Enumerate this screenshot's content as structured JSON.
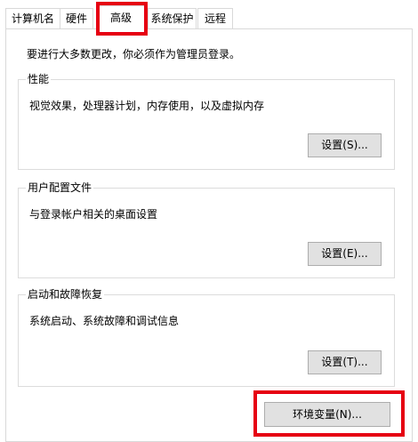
{
  "tabs": [
    {
      "label": "计算机名",
      "active": false
    },
    {
      "label": "硬件",
      "active": false
    },
    {
      "label": "高级",
      "active": true
    },
    {
      "label": "系统保护",
      "active": false
    },
    {
      "label": "远程",
      "active": false
    }
  ],
  "notice": "要进行大多数更改，你必须作为管理员登录。",
  "performance": {
    "title": "性能",
    "description": "视觉效果，处理器计划，内存使用，以及虚拟内存",
    "button": "设置(S)..."
  },
  "user_profiles": {
    "title": "用户配置文件",
    "description": "与登录帐户相关的桌面设置",
    "button": "设置(E)..."
  },
  "startup_recovery": {
    "title": "启动和故障恢复",
    "description": "系统启动、系统故障和调试信息",
    "button": "设置(T)..."
  },
  "env_button": "环境变量(N)...",
  "colors": {
    "highlight": "#e60012",
    "button_bg": "#e1e1e1",
    "border": "#d9d9d9"
  }
}
